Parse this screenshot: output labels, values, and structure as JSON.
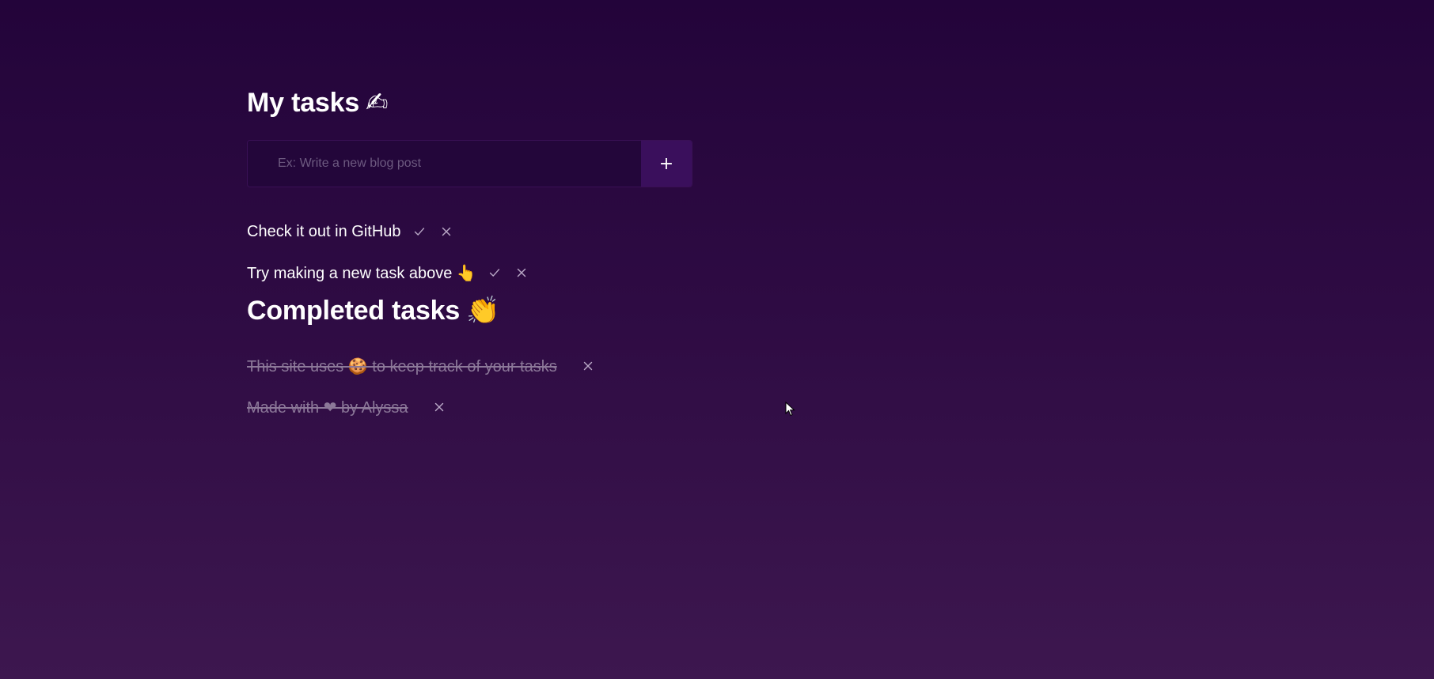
{
  "my_tasks": {
    "title": "My tasks",
    "title_emoji": "✍",
    "input_placeholder": "Ex: Write a new blog post",
    "input_value": "",
    "add_button_label": "+",
    "items": [
      {
        "text": "Check it out in GitHub",
        "completed": false
      },
      {
        "text": "Try making a new task above 👆",
        "completed": false
      }
    ]
  },
  "completed_tasks": {
    "title": "Completed tasks",
    "title_emoji": "👏",
    "items": [
      {
        "text": "This site uses 🍪 to keep track of your tasks",
        "completed": true
      },
      {
        "text": "Made with ❤ by Alyssa",
        "completed": true
      }
    ]
  },
  "icons": {
    "complete": "check-icon",
    "delete": "close-icon"
  },
  "colors": {
    "background_top": "#23043a",
    "background_bottom": "#3d174f",
    "input_background": "#23063a",
    "add_button": "#3a0f5c",
    "completed_text": "#8c7899"
  }
}
